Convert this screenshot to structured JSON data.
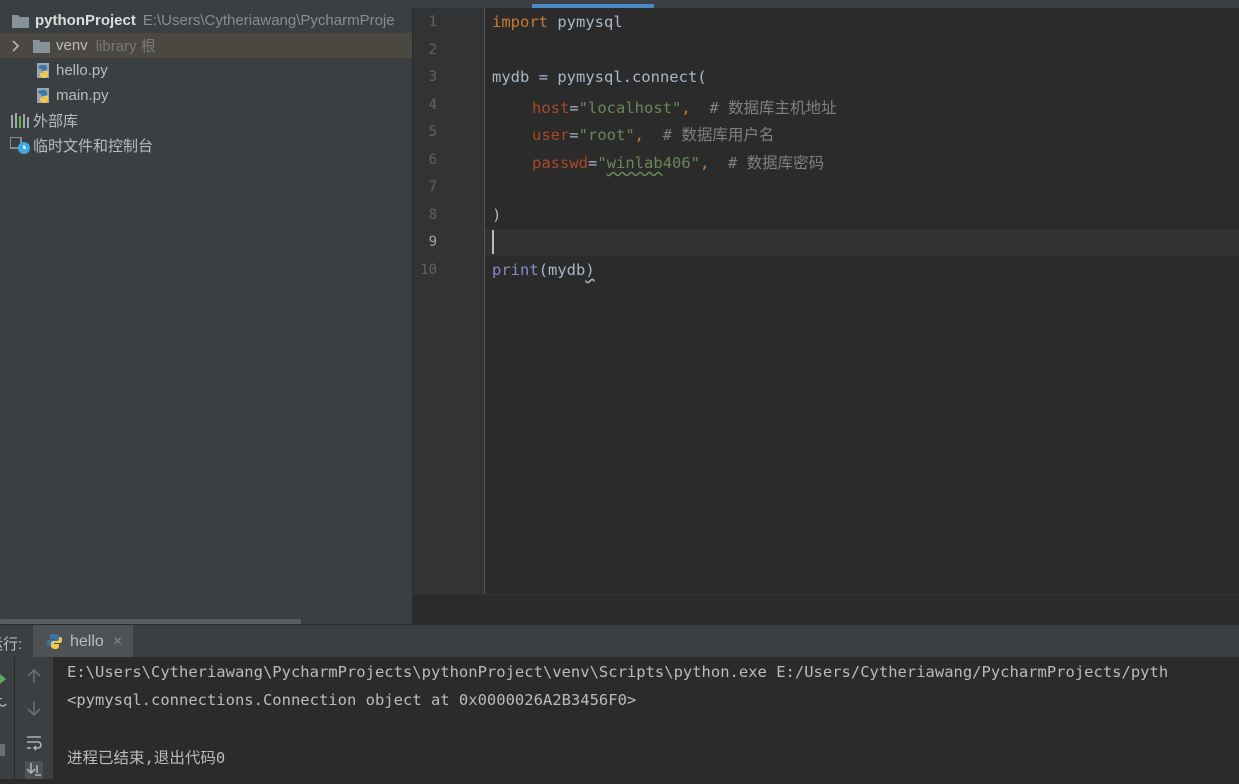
{
  "sidebar": {
    "root_name": "pythonProject",
    "root_path": "E:\\Users\\Cytheriawang\\PycharmProje",
    "items": [
      {
        "label": "venv",
        "hint": "library 根"
      },
      {
        "label": "hello.py"
      },
      {
        "label": "main.py"
      },
      {
        "label": "外部库"
      },
      {
        "label": "临时文件和控制台"
      }
    ]
  },
  "editor": {
    "line_numbers": [
      "1",
      "2",
      "3",
      "4",
      "5",
      "6",
      "7",
      "8",
      "9",
      "10"
    ],
    "code": {
      "l1_kw": "import",
      "l1_rest": " pymysql",
      "l3": "mydb = pymysql.connect(",
      "l4_param": "host",
      "l4_eq": "=",
      "l4_str": "\"localhost\"",
      "l4_comma": ",  ",
      "l4_cmt": "# 数据库主机地址",
      "l5_param": "user",
      "l5_eq": "=",
      "l5_str": "\"root\"",
      "l5_comma": ",  ",
      "l5_cmt": "# 数据库用户名",
      "l6_param": "passwd",
      "l6_eq": "=",
      "l6_q1": "\"",
      "l6_str_sq": "winlab",
      "l6_str_rest": "406\"",
      "l6_comma": ",  ",
      "l6_cmt": "# 数据库密码",
      "l8": ")",
      "l10_builtin": "print",
      "l10_open": "(mydb",
      "l10_close": ")"
    }
  },
  "run_panel": {
    "label": "运行:",
    "tab_label": "hello",
    "tab_close": "×",
    "output": [
      "E:\\Users\\Cytheriawang\\PycharmProjects\\pythonProject\\venv\\Scripts\\python.exe E:/Users/Cytheriawang/PycharmProjects/pyth",
      "<pymysql.connections.Connection object at 0x0000026A2B3456F0>",
      "",
      "进程已结束,退出代码0"
    ]
  },
  "colors": {
    "accent": "#4a88c7",
    "keyword": "#cc7832",
    "string": "#6a8759",
    "comment": "#808080",
    "param": "#aa4926"
  }
}
